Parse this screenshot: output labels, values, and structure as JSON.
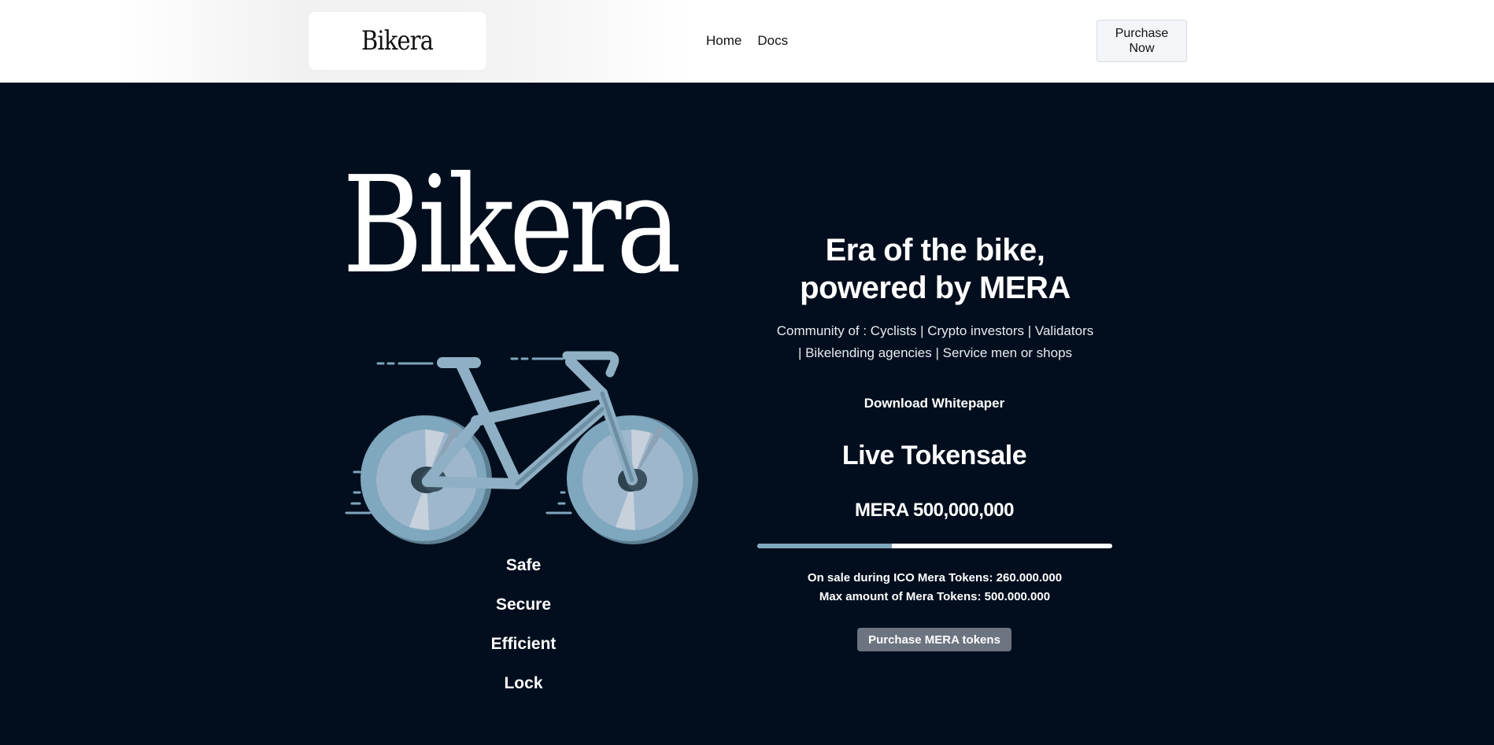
{
  "header": {
    "logo_text": "Bikera",
    "nav": [
      {
        "label": "Home"
      },
      {
        "label": "Docs"
      }
    ],
    "purchase_now_label": "Purchase Now"
  },
  "hero": {
    "brand_title": "Bikera",
    "features": [
      "Safe",
      "Secure",
      "Efficient",
      "Lock"
    ],
    "headline_line1": "Era of the bike,",
    "headline_line2": "powered by MERA",
    "community_line1": "Community of : Cyclists | Crypto investors | Validators",
    "community_line2": "| Bikelending agencies | Service men or shops",
    "download_label": "Download Whitepaper"
  },
  "tokensale": {
    "title": "Live Tokensale",
    "total_label": "MERA 500,000,000",
    "progress_fraction": 0.38,
    "on_sale_text": "On sale during ICO Mera Tokens: 260.000.000",
    "max_amount_text": "Max amount of Mera Tokens: 500.000.000",
    "buy_label": "Purchase MERA tokens"
  },
  "colors": {
    "background": "#020e1d",
    "accent": "#7fa7bd",
    "button": "#6b7480"
  },
  "icons": [
    "bicycle-illustration"
  ]
}
